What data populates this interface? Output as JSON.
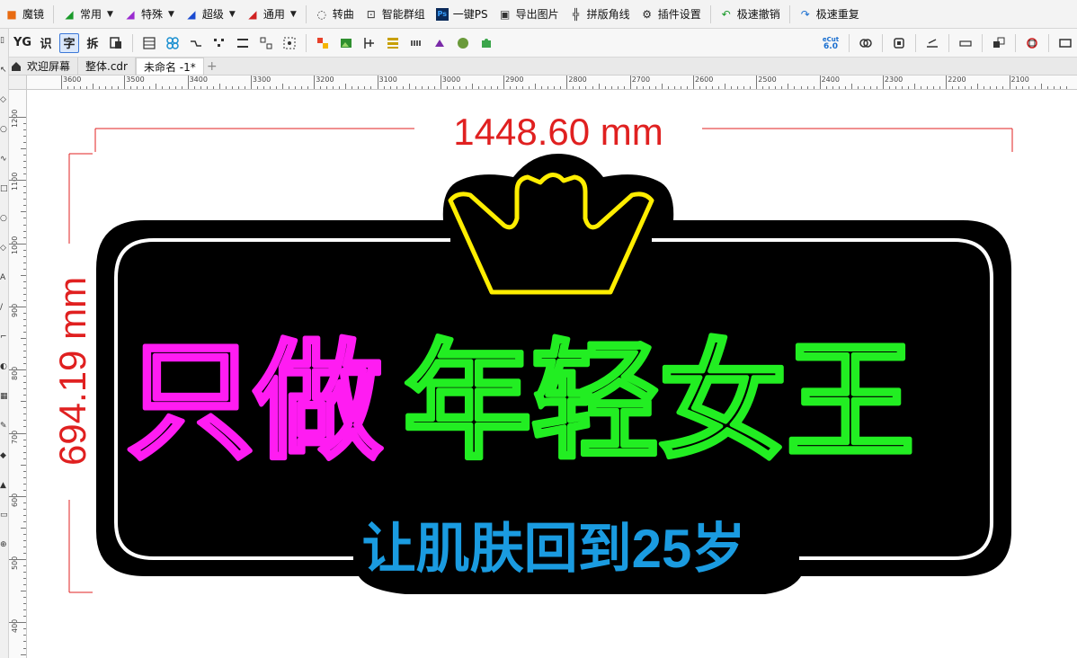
{
  "toolbar_top": {
    "items": [
      {
        "label": "魔镜",
        "icon": "magic-mirror-icon"
      },
      {
        "label": "常用",
        "icon": "arrow-green-icon",
        "dropdown": true
      },
      {
        "label": "特殊",
        "icon": "arrow-purple-icon",
        "dropdown": true
      },
      {
        "label": "超级",
        "icon": "arrow-blue-icon",
        "dropdown": true
      },
      {
        "label": "通用",
        "icon": "arrow-red-icon",
        "dropdown": true
      },
      {
        "label": "转曲",
        "icon": "convert-curve-icon"
      },
      {
        "label": "智能群组",
        "icon": "smart-group-icon"
      },
      {
        "label": "一键PS",
        "icon": "photoshop-icon"
      },
      {
        "label": "导出图片",
        "icon": "export-image-icon"
      },
      {
        "label": "拼版角线",
        "icon": "crop-marks-icon"
      },
      {
        "label": "插件设置",
        "icon": "gear-icon"
      },
      {
        "label": "极速撤销",
        "icon": "undo-icon"
      },
      {
        "label": "极速重复",
        "icon": "redo-icon"
      }
    ]
  },
  "toolbar_second": {
    "text_buttons": [
      "YG",
      "识",
      "字",
      "拆"
    ],
    "version_badge": {
      "top": "eCut",
      "bottom": "6.0"
    }
  },
  "tabs": [
    {
      "label": "欢迎屏幕"
    },
    {
      "label": "整体.cdr"
    },
    {
      "label": "未命名 -1*"
    }
  ],
  "ruler_h": [
    "3600",
    "3500",
    "3400",
    "3300",
    "3200",
    "3100",
    "3000",
    "2900",
    "2800",
    "2700",
    "2600",
    "2500",
    "2400",
    "2300",
    "2200",
    "2100"
  ],
  "ruler_v": [
    "1200",
    "1100",
    "1000",
    "900",
    "800",
    "700",
    "600",
    "500",
    "400"
  ],
  "design": {
    "width_dim": "1448.60 mm",
    "height_dim": "694.19 mm",
    "headline_magenta": "只做",
    "headline_green": "年轻女王",
    "subtitle": "让肌肤回到25岁",
    "colors": {
      "dimension": "#e02020",
      "magenta": "#ff1cf2",
      "green": "#22ee22",
      "yellow": "#ffee00",
      "blue": "#1a9be0",
      "board": "#000000",
      "inner_border": "#ffffff"
    }
  }
}
